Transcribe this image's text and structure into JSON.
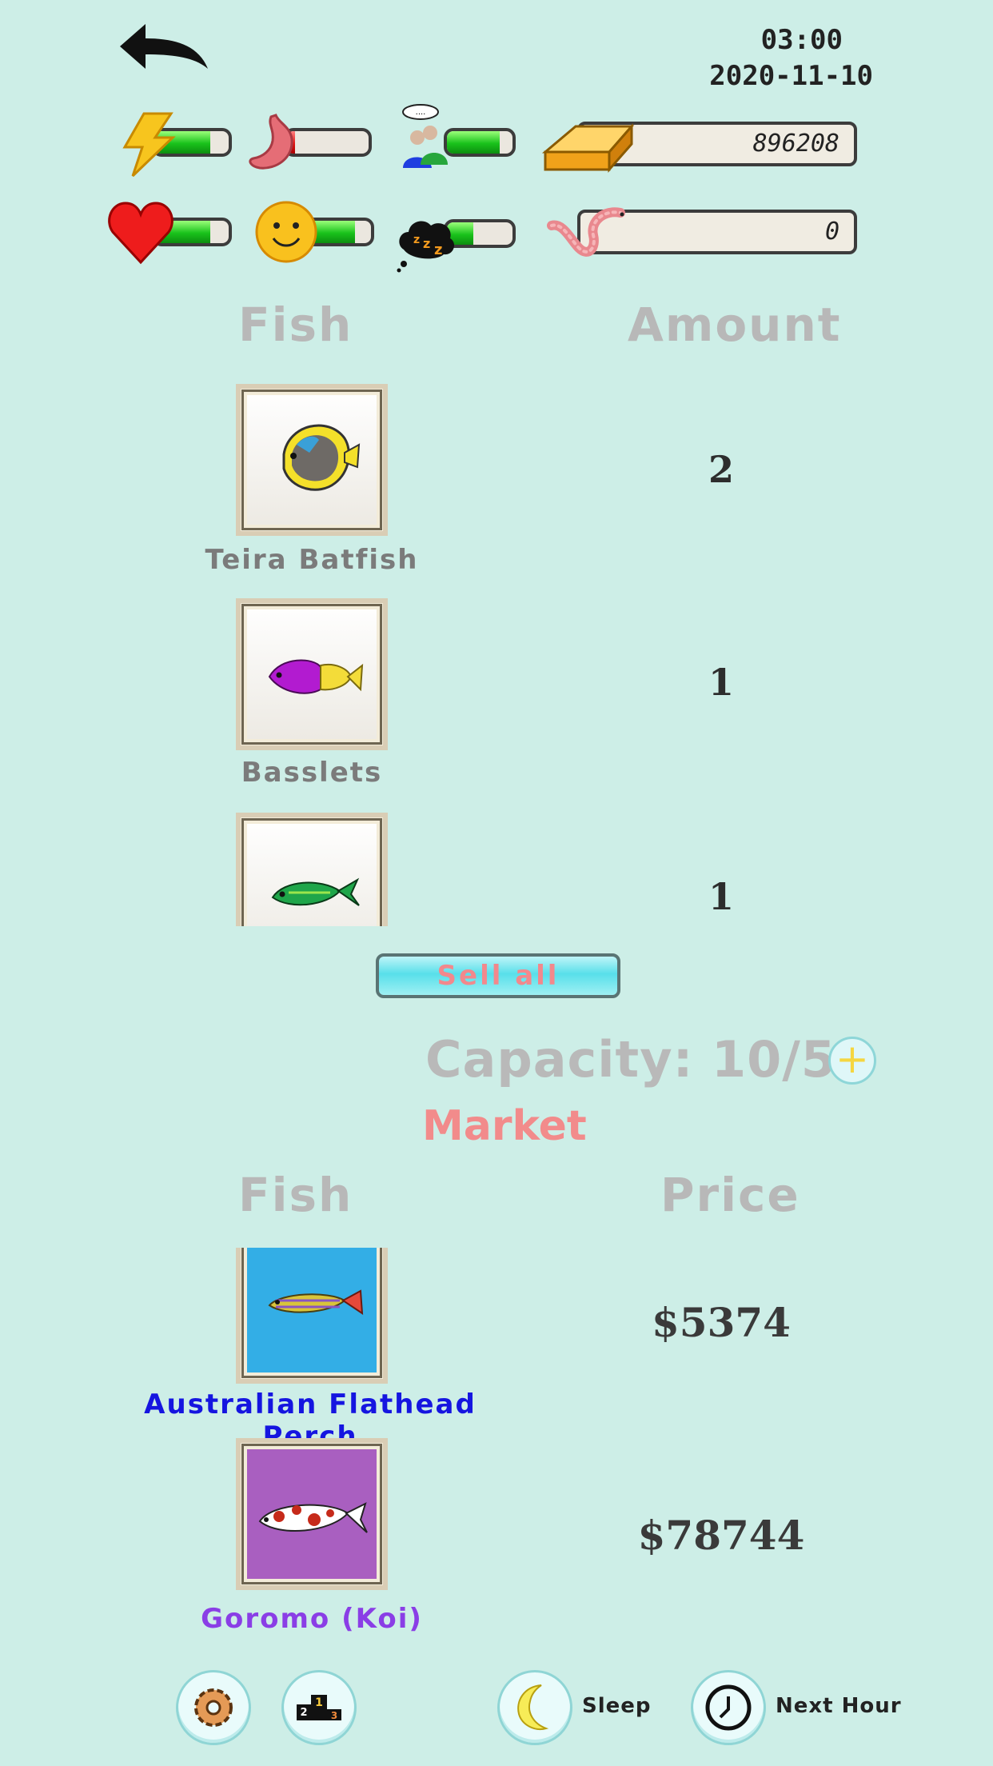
{
  "header": {
    "time": "03:00",
    "date": "2020-11-10"
  },
  "stats": {
    "energy": {
      "icon": "lightning-icon",
      "level": 0.75
    },
    "hunger": {
      "icon": "stomach-icon",
      "level": 0.1
    },
    "social": {
      "icon": "people-icon",
      "level": 0.8
    },
    "health": {
      "icon": "heart-icon",
      "level": 0.75
    },
    "happiness": {
      "icon": "smiley-icon",
      "level": 0.75
    },
    "sleep": {
      "icon": "sleep-cloud-icon",
      "level": 0.4
    },
    "gold": {
      "icon": "gold-bar-icon",
      "value": "896208"
    },
    "bait": {
      "icon": "worm-icon",
      "value": "0"
    }
  },
  "inventory": {
    "fish_header": "Fish",
    "amount_header": "Amount",
    "items": [
      {
        "name": "Teira Batfish",
        "amount": "2"
      },
      {
        "name": "Basslets",
        "amount": "1"
      },
      {
        "name": "",
        "amount": "1"
      }
    ],
    "sell_all_label": "Sell all",
    "capacity": "Capacity: 10/50",
    "plus_label": "+"
  },
  "market": {
    "title": "Market",
    "fish_header": "Fish",
    "price_header": "Price",
    "items": [
      {
        "name": "Australian Flathead Perch",
        "price": "$5374",
        "name_color": "#1515e0",
        "frame_color": "#33aee6"
      },
      {
        "name": "Goromo (Koi)",
        "price": "$78744",
        "name_color": "#8a3ee6",
        "frame_color": "#a95fc0"
      }
    ]
  },
  "bottom_bar": {
    "sleep_label": "Sleep",
    "next_hour_label": "Next Hour"
  },
  "colors": {
    "background": "#cdeee7",
    "bar_green": "#19c31b",
    "bar_red": "#e01818"
  }
}
